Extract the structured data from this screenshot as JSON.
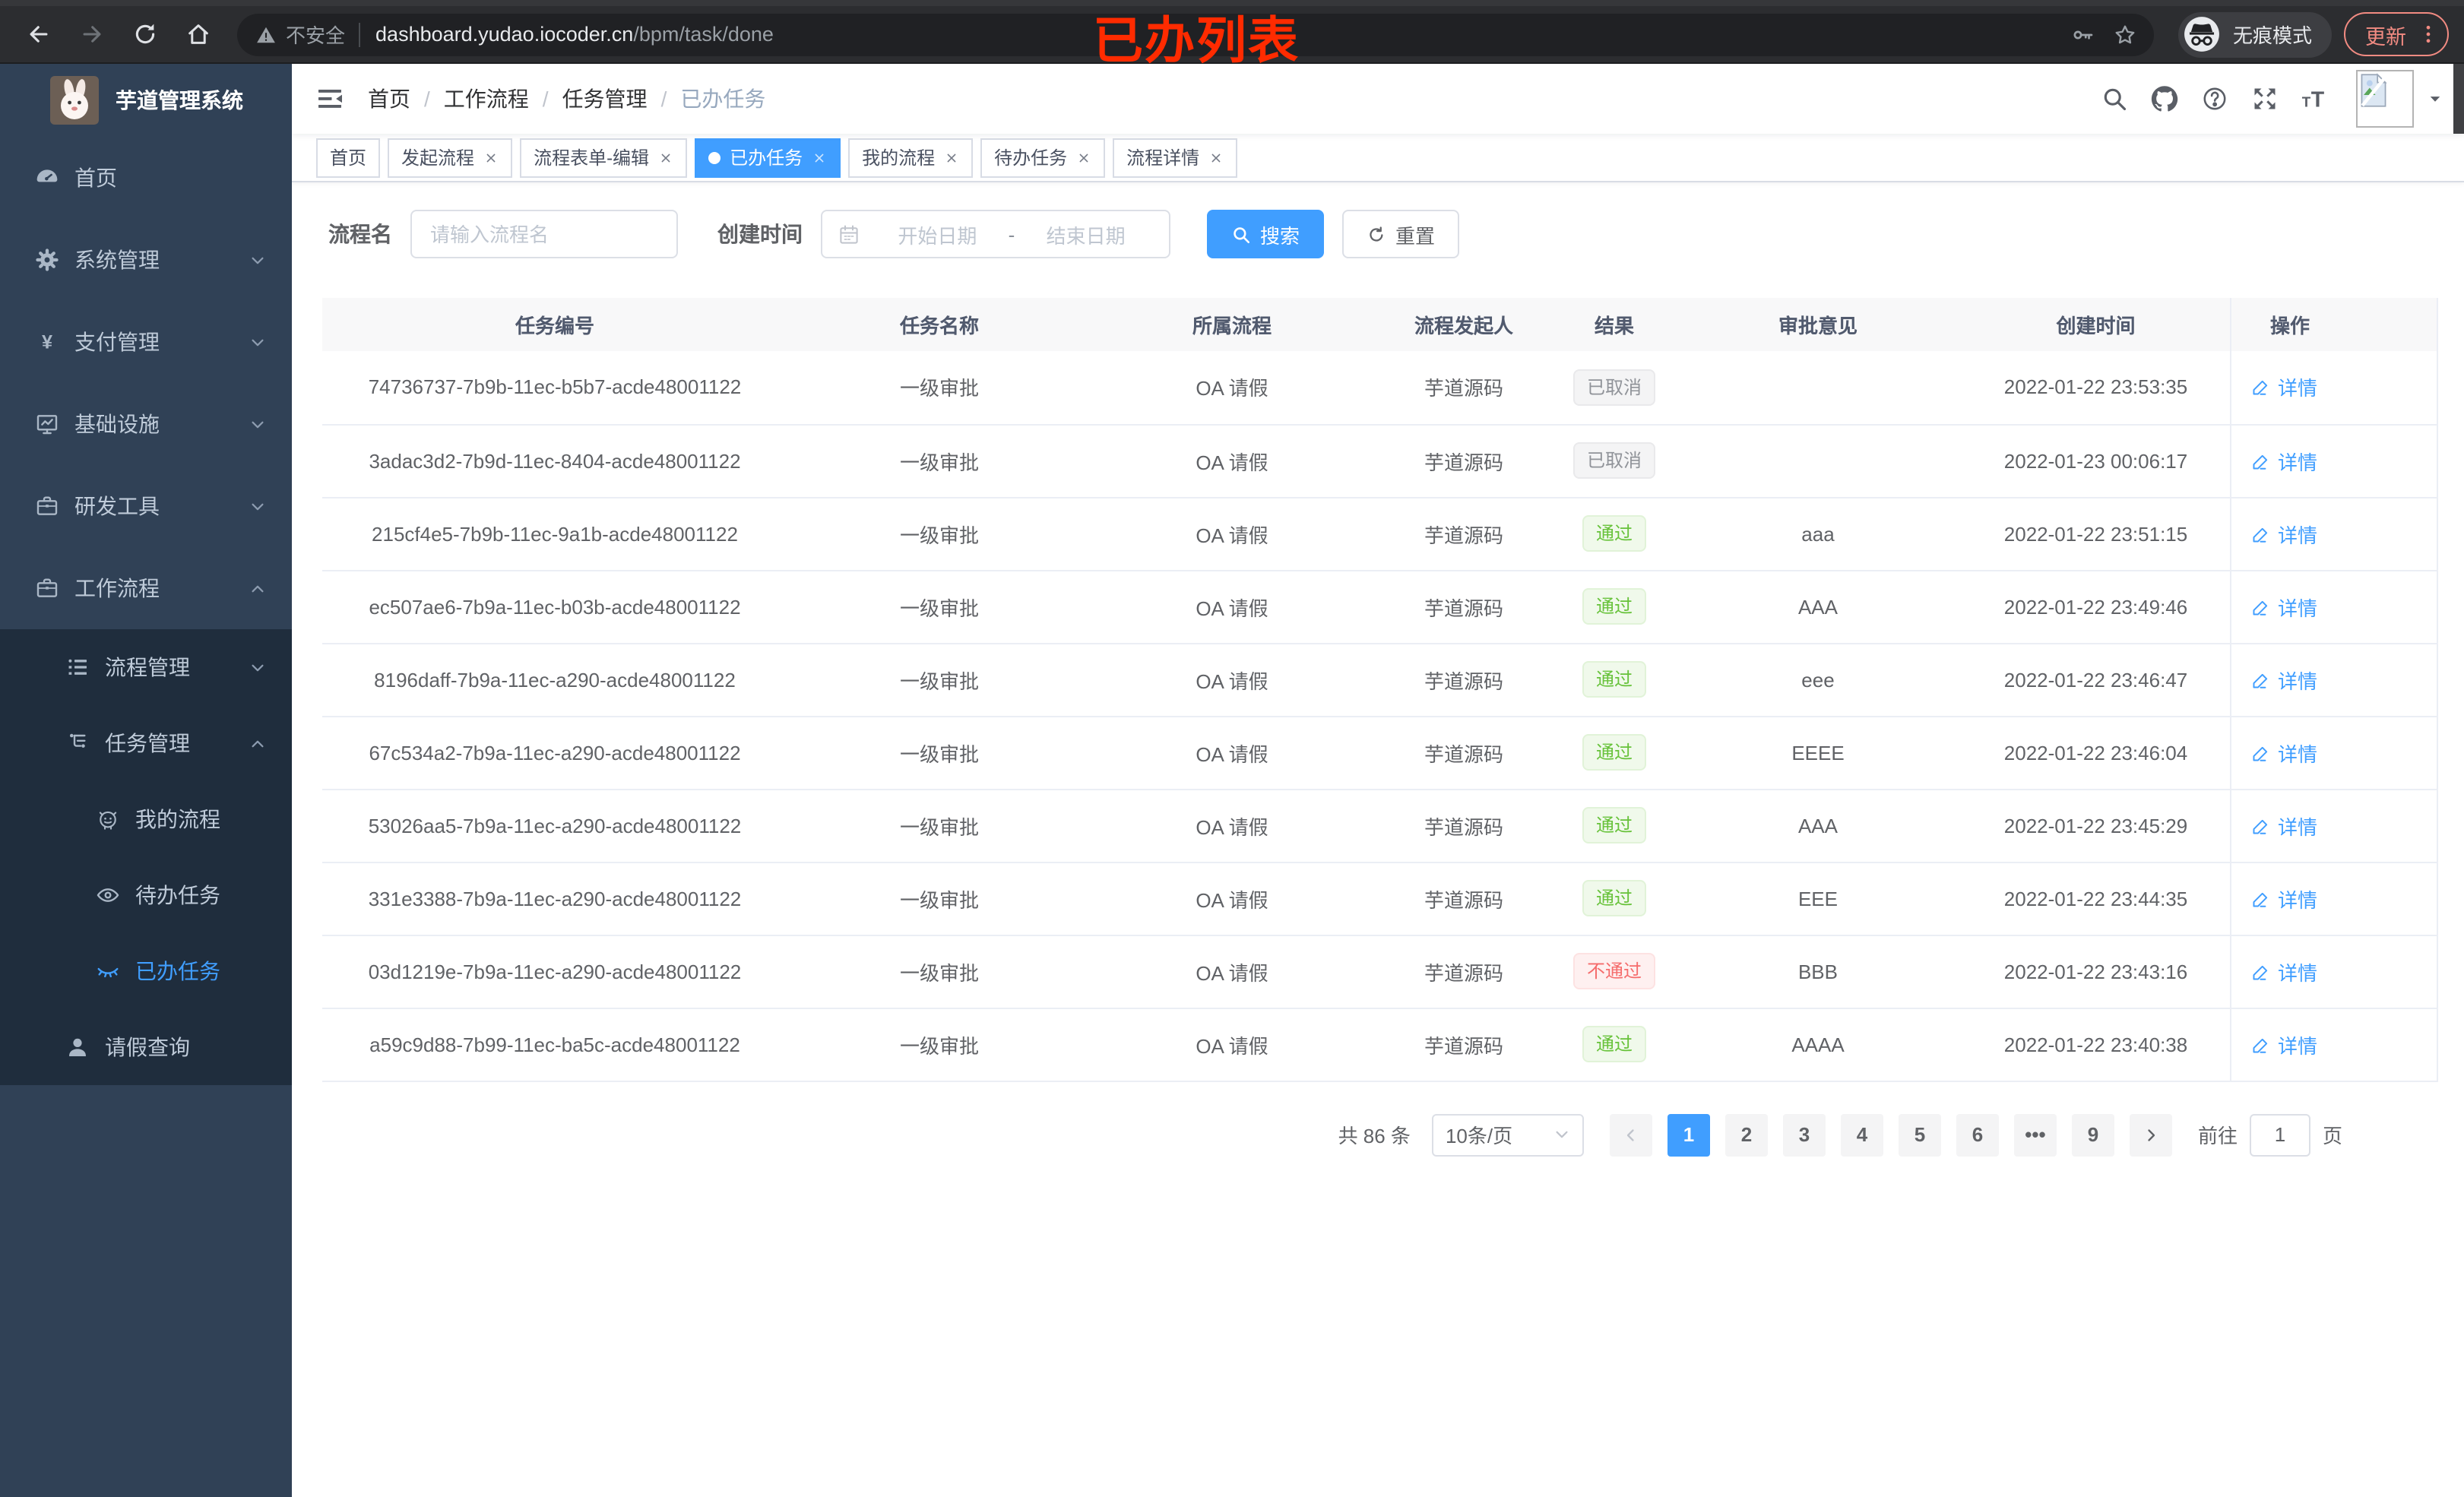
{
  "colors": {
    "accent": "#409eff",
    "success": "#67c23a",
    "danger": "#f56c6c",
    "info": "#909399",
    "sidebar-bg": "#304156",
    "submenu-bg": "#1f2d3d",
    "annotation": "#ff2b00"
  },
  "browser": {
    "security_label": "不安全",
    "url_domain": "dashboard.yudao.iocoder.cn",
    "url_path": "/bpm/task/done",
    "incognito_label": "无痕模式",
    "update_label": "更新",
    "annotation": "已办列表"
  },
  "sidebar": {
    "app_title": "芋道管理系统",
    "items": [
      {
        "key": "home",
        "label": "首页",
        "icon": "dashboard",
        "level": 1
      },
      {
        "key": "system",
        "label": "系统管理",
        "icon": "gear",
        "level": 1,
        "chevron": "down"
      },
      {
        "key": "payment",
        "label": "支付管理",
        "icon": "yen",
        "level": 1,
        "chevron": "down"
      },
      {
        "key": "infrastructure",
        "label": "基础设施",
        "icon": "monitor",
        "level": 1,
        "chevron": "down"
      },
      {
        "key": "devtools",
        "label": "研发工具",
        "icon": "briefcase",
        "level": 1,
        "chevron": "down"
      },
      {
        "key": "workflow",
        "label": "工作流程",
        "icon": "briefcase",
        "level": 1,
        "chevron": "up"
      },
      {
        "key": "process-mgmt",
        "label": "流程管理",
        "icon": "list",
        "level": 2,
        "dark": true,
        "chevron": "down"
      },
      {
        "key": "task-mgmt",
        "label": "任务管理",
        "icon": "tree",
        "level": 2,
        "dark": true,
        "chevron": "up"
      },
      {
        "key": "my-process",
        "label": "我的流程",
        "icon": "robot",
        "level": 3,
        "dark": true
      },
      {
        "key": "todo-task",
        "label": "待办任务",
        "icon": "eye-open",
        "level": 3,
        "dark": true
      },
      {
        "key": "done-task",
        "label": "已办任务",
        "icon": "eye-close",
        "level": 3,
        "dark": true,
        "active": true
      },
      {
        "key": "leave-query",
        "label": "请假查询",
        "icon": "user",
        "level": 2,
        "dark": true
      }
    ]
  },
  "header": {
    "breadcrumb": [
      "首页",
      "工作流程",
      "任务管理",
      "已办任务"
    ],
    "separator": "/"
  },
  "tags": [
    {
      "key": "home",
      "label": "首页"
    },
    {
      "key": "start-process",
      "label": "发起流程",
      "closable": true
    },
    {
      "key": "form-edit",
      "label": "流程表单-编辑",
      "closable": true
    },
    {
      "key": "done-task",
      "label": "已办任务",
      "closable": true,
      "active": true
    },
    {
      "key": "my-process",
      "label": "我的流程",
      "closable": true
    },
    {
      "key": "todo-task",
      "label": "待办任务",
      "closable": true
    },
    {
      "key": "process-detail",
      "label": "流程详情",
      "closable": true
    }
  ],
  "filters": {
    "name_label": "流程名",
    "name_placeholder": "请输入流程名",
    "time_label": "创建时间",
    "start_placeholder": "开始日期",
    "range_separator": "-",
    "end_placeholder": "结束日期",
    "search_label": "搜索",
    "reset_label": "重置"
  },
  "table": {
    "columns": [
      "任务编号",
      "任务名称",
      "所属流程",
      "流程发起人",
      "结果",
      "审批意见",
      "创建时间",
      "操作"
    ],
    "detail_label": "详情",
    "rows": [
      {
        "id": "74736737-7b9b-11ec-b5b7-acde48001122",
        "name": "一级审批",
        "process": "OA 请假",
        "starter": "芋道源码",
        "result": "已取消",
        "result_type": "info",
        "comment": "",
        "time": "2022-01-22 23:53:35"
      },
      {
        "id": "3adac3d2-7b9d-11ec-8404-acde48001122",
        "name": "一级审批",
        "process": "OA 请假",
        "starter": "芋道源码",
        "result": "已取消",
        "result_type": "info",
        "comment": "",
        "time": "2022-01-23 00:06:17"
      },
      {
        "id": "215cf4e5-7b9b-11ec-9a1b-acde48001122",
        "name": "一级审批",
        "process": "OA 请假",
        "starter": "芋道源码",
        "result": "通过",
        "result_type": "success",
        "comment": "aaa",
        "time": "2022-01-22 23:51:15"
      },
      {
        "id": "ec507ae6-7b9a-11ec-b03b-acde48001122",
        "name": "一级审批",
        "process": "OA 请假",
        "starter": "芋道源码",
        "result": "通过",
        "result_type": "success",
        "comment": "AAA",
        "time": "2022-01-22 23:49:46"
      },
      {
        "id": "8196daff-7b9a-11ec-a290-acde48001122",
        "name": "一级审批",
        "process": "OA 请假",
        "starter": "芋道源码",
        "result": "通过",
        "result_type": "success",
        "comment": "eee",
        "time": "2022-01-22 23:46:47"
      },
      {
        "id": "67c534a2-7b9a-11ec-a290-acde48001122",
        "name": "一级审批",
        "process": "OA 请假",
        "starter": "芋道源码",
        "result": "通过",
        "result_type": "success",
        "comment": "EEEE",
        "time": "2022-01-22 23:46:04"
      },
      {
        "id": "53026aa5-7b9a-11ec-a290-acde48001122",
        "name": "一级审批",
        "process": "OA 请假",
        "starter": "芋道源码",
        "result": "通过",
        "result_type": "success",
        "comment": "AAA",
        "time": "2022-01-22 23:45:29"
      },
      {
        "id": "331e3388-7b9a-11ec-a290-acde48001122",
        "name": "一级审批",
        "process": "OA 请假",
        "starter": "芋道源码",
        "result": "通过",
        "result_type": "success",
        "comment": "EEE",
        "time": "2022-01-22 23:44:35"
      },
      {
        "id": "03d1219e-7b9a-11ec-a290-acde48001122",
        "name": "一级审批",
        "process": "OA 请假",
        "starter": "芋道源码",
        "result": "不通过",
        "result_type": "danger",
        "comment": "BBB",
        "time": "2022-01-22 23:43:16"
      },
      {
        "id": "a59c9d88-7b99-11ec-ba5c-acde48001122",
        "name": "一级审批",
        "process": "OA 请假",
        "starter": "芋道源码",
        "result": "通过",
        "result_type": "success",
        "comment": "AAAA",
        "time": "2022-01-22 23:40:38"
      }
    ]
  },
  "pagination": {
    "total_label": "共 86 条",
    "page_size_value": "10条/页",
    "pages": [
      {
        "label": "1",
        "active": true
      },
      {
        "label": "2"
      },
      {
        "label": "3"
      },
      {
        "label": "4"
      },
      {
        "label": "5"
      },
      {
        "label": "6"
      },
      {
        "label": "•••",
        "more": true
      },
      {
        "label": "9"
      }
    ],
    "goto_label": "前往",
    "goto_value": "1",
    "page_unit": "页"
  }
}
